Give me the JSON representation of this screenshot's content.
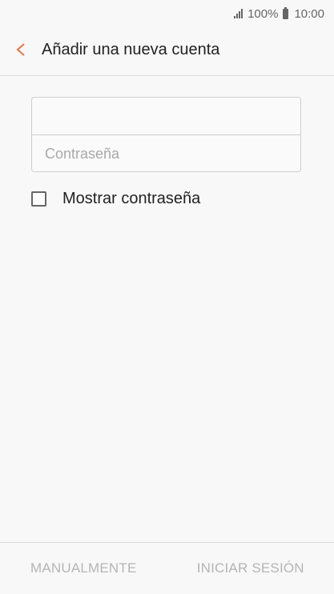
{
  "status_bar": {
    "battery": "100%",
    "time": "10:00"
  },
  "header": {
    "title": "Añadir una nueva cuenta",
    "back_icon": "chevron-left-icon",
    "accent_color": "#e0764b"
  },
  "form": {
    "email_value": "",
    "email_placeholder": "",
    "password_placeholder": "Contraseña"
  },
  "show_password": {
    "label": "Mostrar contraseña",
    "checked": false
  },
  "bottom_bar": {
    "manual_label": "MANUALMENTE",
    "login_label": "INICIAR SESIÓN"
  }
}
